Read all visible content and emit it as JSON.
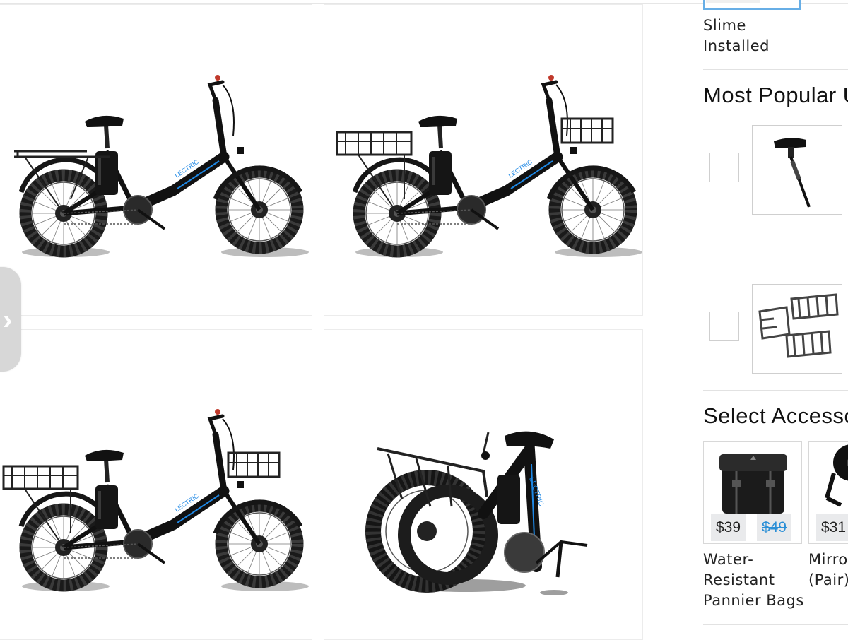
{
  "gallery": {
    "images": [
      {
        "alt": "Step-through e-bike with rear rack",
        "brand_text": "LECTRIC"
      },
      {
        "alt": "Step-through e-bike with front and rear baskets",
        "brand_text": "LECTRIC"
      },
      {
        "alt": "Step-through e-bike with front and rear baskets",
        "brand_text": "LECTRIC"
      },
      {
        "alt": "Folded e-bike",
        "brand_text": "LECTRIC"
      }
    ]
  },
  "sidebar": {
    "selected_variant": {
      "label": "Slime Installed"
    },
    "most_popular": {
      "title": "Most Popular U",
      "items": [
        {
          "icon": "seatpost-suspension-icon"
        },
        {
          "icon": "basket-set-icon"
        }
      ]
    },
    "accessories": {
      "title": "Select Accesso",
      "items": [
        {
          "price": "$39",
          "old_price": "$49",
          "name": "Water-Resistant Pannier Bags",
          "name_line1": "Water-",
          "name_line2": "Resistant",
          "name_line3": "Pannier Bags"
        },
        {
          "price": "$31",
          "name": "Mirror (Pair)",
          "name_line1": "Mirror",
          "name_line2": "(Pair)"
        }
      ]
    }
  },
  "colors": {
    "accent": "#2b8fd6",
    "frame": "#111111",
    "frame_accent": "#1e88e5",
    "handle": "#d7d7d7"
  }
}
